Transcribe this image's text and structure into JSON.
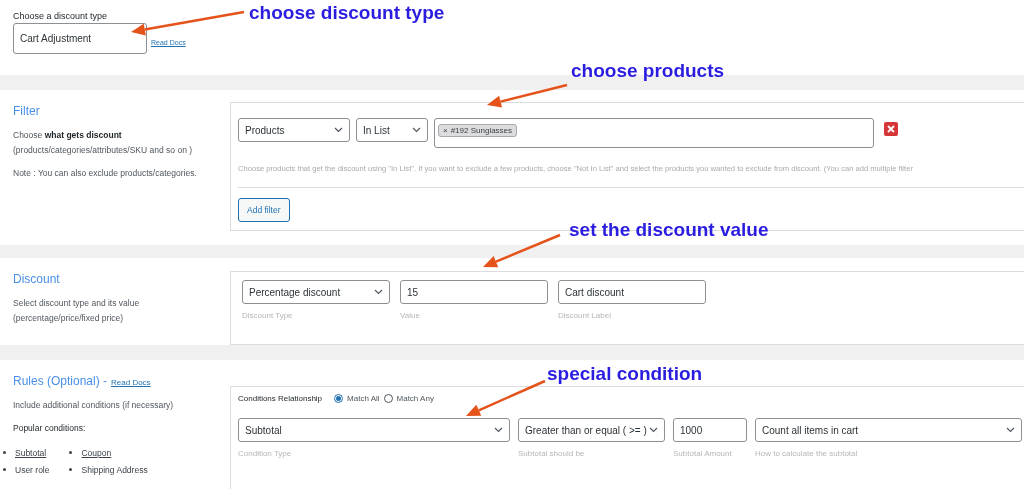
{
  "discount_type": {
    "label": "Choose a discount type",
    "value": "Cart Adjustment",
    "docs_link": "Read Docs"
  },
  "annotations": [
    {
      "text": "choose discount type"
    },
    {
      "text": "choose products"
    },
    {
      "text": "set the discount value"
    },
    {
      "text": "special condition"
    }
  ],
  "filter": {
    "title": "Filter",
    "description": "Choose **what gets discount**\n(products/categories/attributes/SKU and so on )",
    "note": "Note : You can also exclude products/categories.",
    "rows": [
      {
        "type": "Products",
        "operator": "In List",
        "tags": [
          {
            "remove": "×",
            "label": "#192 Sunglasses"
          }
        ]
      }
    ],
    "help": "Choose products that get the discount using \"In List\". If you want to exclude a few products, choose \"Not In List\" and select the products you wanted to exclude from discount. (You can add multiple filter",
    "add_button": "Add filter"
  },
  "discount": {
    "title": "Discount",
    "description": "Select discount type and its value\n(percentage/price/fixed price)",
    "fields": [
      {
        "kind": "select",
        "value": "Percentage discount",
        "caption": "Discount Type"
      },
      {
        "kind": "input",
        "value": "15",
        "caption": "Value"
      },
      {
        "kind": "input",
        "value": "Cart discount",
        "caption": "Discount Label"
      }
    ]
  },
  "rules": {
    "title": "Rules (Optional) -",
    "docs_link": "Read Docs",
    "description": "Include additional conditions (if necessary)",
    "popular_title": "Popular conditions:",
    "popular": [
      [
        {
          "label": "Subtotal",
          "link": true
        },
        {
          "label": "User role",
          "link": false
        }
      ],
      [
        {
          "label": "Coupon",
          "link": true
        },
        {
          "label": "Shipping Address",
          "link": false
        }
      ]
    ],
    "relationship_label": "Conditions Relationship",
    "relationship_options": [
      {
        "label": "Match All",
        "selected": true
      },
      {
        "label": "Match Any",
        "selected": false
      }
    ],
    "fields": [
      {
        "kind": "select",
        "value": "Subtotal",
        "caption": "Condition Type"
      },
      {
        "kind": "select",
        "value": "Greater than or equal ( >= )",
        "caption": "Subtotal should be"
      },
      {
        "kind": "input",
        "value": "1000",
        "caption": "Subtotal Amount"
      },
      {
        "kind": "select",
        "value": "Count all items in cart",
        "caption": "How to calculate the subtotal"
      }
    ]
  }
}
